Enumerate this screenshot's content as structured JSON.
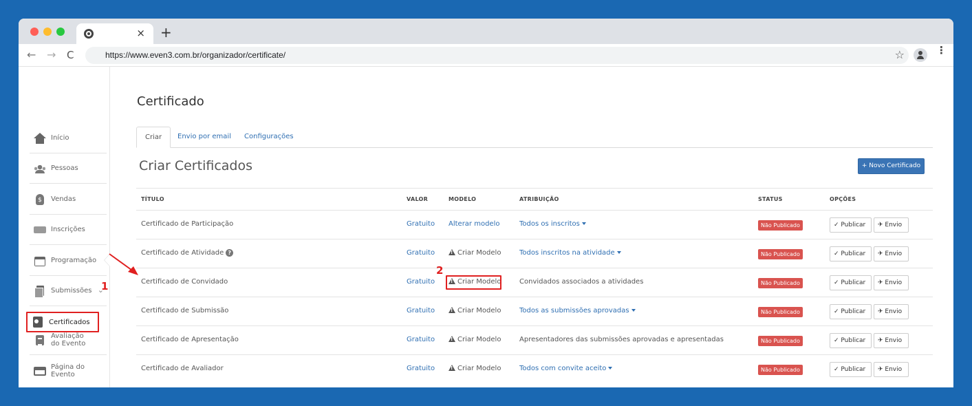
{
  "browser": {
    "url": "https://www.even3.com.br/organizador/certificate/",
    "tab_close": "×",
    "new_tab": "+",
    "back": "←",
    "forward": "→",
    "reload": "C",
    "star": "☆",
    "menu": "⋮"
  },
  "sidebar": {
    "items": [
      {
        "label": "Início",
        "icon": "home-icon"
      },
      {
        "label": "Pessoas",
        "icon": "people-icon"
      },
      {
        "label": "Vendas",
        "icon": "money-bag-icon"
      },
      {
        "label": "Inscrições",
        "icon": "ticket-icon"
      },
      {
        "label": "Programação",
        "icon": "calendar-icon"
      },
      {
        "label": "Submissões",
        "icon": "documents-icon",
        "chevron": "⌄"
      },
      {
        "label": "Certificados",
        "icon": "certificate-icon"
      },
      {
        "label": "Avaliação do Evento",
        "line1": "Avaliação",
        "line2": "do Evento",
        "icon": "clipboard-icon"
      },
      {
        "label": "Página do Evento",
        "line1": "Página do",
        "line2": "Evento",
        "icon": "webpage-icon"
      }
    ]
  },
  "main": {
    "page_title": "Certificado",
    "tabs": [
      "Criar",
      "Envio por email",
      "Configurações"
    ],
    "section_title": "Criar Certificados",
    "new_button": "+ Novo Certificado",
    "columns": [
      "TÍTULO",
      "VALOR",
      "MODELO",
      "ATRIBUIÇÃO",
      "STATUS",
      "OPÇÕES"
    ],
    "rows": [
      {
        "titulo": "Certificado de Participação",
        "valor": "Gratuito",
        "modelo": "Alterar modelo",
        "atribuicao": "Todos os inscritos",
        "status": "Não Publicado"
      },
      {
        "titulo": "Certificado de Atividade",
        "valor": "Gratuito",
        "modelo": "Criar Modelo",
        "atribuicao": "Todos inscritos na atividade",
        "status": "Não Publicado"
      },
      {
        "titulo": "Certificado de Convidado",
        "valor": "Gratuito",
        "modelo": "Criar Modelo",
        "atribuicao": "Convidados associados a atividades",
        "status": "Não Publicado"
      },
      {
        "titulo": "Certificado de Submissão",
        "valor": "Gratuito",
        "modelo": "Criar Modelo",
        "atribuicao": "Todos as submissões aprovadas",
        "status": "Não Publicado"
      },
      {
        "titulo": "Certificado de Apresentação",
        "valor": "Gratuito",
        "modelo": "Criar Modelo",
        "atribuicao": "Apresentadores das submissões aprovadas e apresentadas",
        "status": "Não Publicado"
      },
      {
        "titulo": "Certificado de Avaliador",
        "valor": "Gratuito",
        "modelo": "Criar Modelo",
        "atribuicao": "Todos com convite aceito",
        "status": "Não Publicado"
      }
    ],
    "publish_label": "✓ Publicar",
    "send_label": "✈ Envio",
    "help_glyph": "?"
  },
  "annotations": {
    "step1": "1",
    "step2": "2",
    "color": "#e02020"
  }
}
